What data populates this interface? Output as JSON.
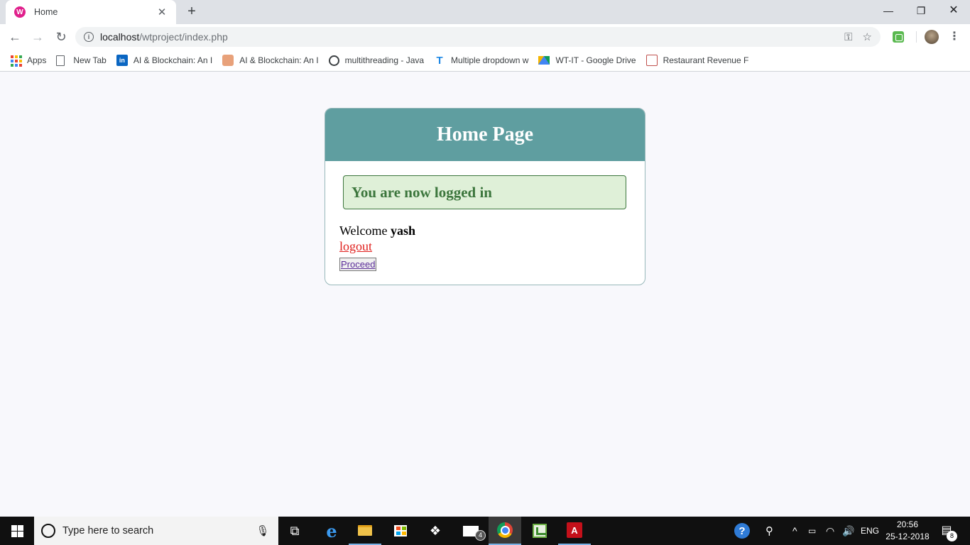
{
  "browser": {
    "tab": {
      "title": "Home",
      "favicon": "W"
    },
    "window_controls": {
      "minimize": "—",
      "maximize": "❐",
      "close": "✕"
    },
    "url": {
      "host": "localhost",
      "path": "/wtproject/index.php"
    },
    "bookmarks": [
      {
        "label": "Apps",
        "icon": "apps-grid-icon"
      },
      {
        "label": "New Tab",
        "icon": "page-icon"
      },
      {
        "label": "AI & Blockchain: An I",
        "icon": "linkedin-icon"
      },
      {
        "label": "AI & Blockchain: An I",
        "icon": "avatar-icon"
      },
      {
        "label": "multithreading - Java",
        "icon": "globe-icon"
      },
      {
        "label": "Multiple dropdown w",
        "icon": "t-icon"
      },
      {
        "label": "WT-IT - Google Drive",
        "icon": "google-drive-icon"
      },
      {
        "label": "Restaurant Revenue F",
        "icon": "presentation-icon"
      }
    ]
  },
  "page": {
    "header_title": "Home Page",
    "alert_message": "You are now logged in",
    "welcome_prefix": "Welcome",
    "username": "yash",
    "logout_label": "logout",
    "proceed_label": "Proceed"
  },
  "colors": {
    "header_bg": "#5f9ea0",
    "alert_bg": "#dff0d8",
    "alert_text": "#3c763d",
    "logout_link": "#e0201e",
    "page_bg": "#f8f8fc"
  },
  "taskbar": {
    "search_placeholder": "Type here to search",
    "mail_badge": "4",
    "language": "ENG",
    "time": "20:56",
    "date": "25-12-2018",
    "notification_count": "8"
  }
}
